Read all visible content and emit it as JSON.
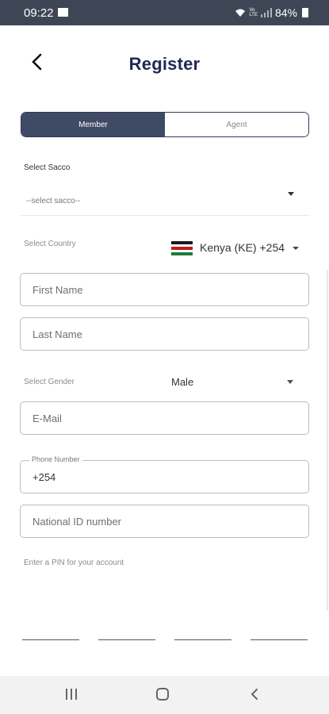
{
  "status": {
    "time": "09:22",
    "battery": "84%"
  },
  "header": {
    "title": "Register"
  },
  "toggle": {
    "member": "Member",
    "agent": "Agent",
    "selected": "Member"
  },
  "sacco": {
    "label": "Select Sacco",
    "value": "--select sacco--"
  },
  "country": {
    "label": "Select Country",
    "value": "Kenya (KE)  +254"
  },
  "fields": {
    "first_name": "First Name",
    "last_name": "Last Name",
    "email": "E-Mail",
    "phone_label": "Phone Number",
    "phone_value": "+254",
    "national_id": "National ID number"
  },
  "gender": {
    "label": "Select Gender",
    "value": "Male"
  },
  "pin": {
    "label": "Enter a PIN for your account"
  },
  "colors": {
    "accent": "#1f2a52",
    "toggle_active": "#3f4a64",
    "statusbar": "#3e4656"
  }
}
